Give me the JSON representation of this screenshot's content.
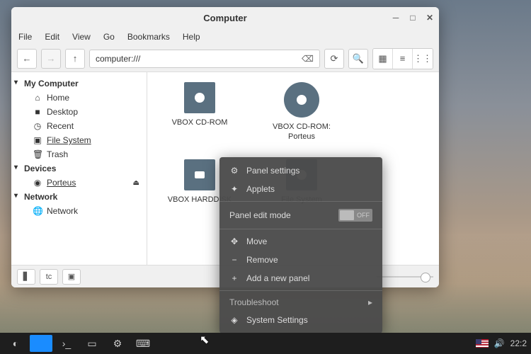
{
  "window": {
    "title": "Computer",
    "menus": [
      "File",
      "Edit",
      "View",
      "Go",
      "Bookmarks",
      "Help"
    ],
    "url": "computer:///"
  },
  "sidebar": {
    "groups": [
      {
        "label": "My Computer",
        "items": [
          {
            "icon": "home-icon",
            "glyph": "⌂",
            "label": "Home"
          },
          {
            "icon": "desktop-icon",
            "glyph": "■",
            "label": "Desktop"
          },
          {
            "icon": "recent-icon",
            "glyph": "◷",
            "label": "Recent"
          },
          {
            "icon": "filesystem-icon",
            "glyph": "▣",
            "label": "File System",
            "selected": true
          },
          {
            "icon": "trash-icon",
            "glyph": "🗑",
            "label": "Trash"
          }
        ]
      },
      {
        "label": "Devices",
        "items": [
          {
            "icon": "disc-icon",
            "glyph": "◉",
            "label": "Porteus",
            "eject": true
          }
        ]
      },
      {
        "label": "Network",
        "items": [
          {
            "icon": "network-icon",
            "glyph": "🌐",
            "label": "Network"
          }
        ]
      }
    ]
  },
  "drives": [
    {
      "label": "VBOX CD-ROM",
      "style": "square"
    },
    {
      "label": "VBOX CD-ROM: Porteus",
      "style": "disc"
    },
    {
      "label": "VBOX HARDDISK",
      "style": "hdd"
    },
    {
      "label": "File System",
      "style": "square"
    }
  ],
  "context": {
    "panel_settings": "Panel settings",
    "applets": "Applets",
    "edit_mode": "Panel edit mode",
    "edit_state": "OFF",
    "move": "Move",
    "remove": "Remove",
    "add": "Add a new panel",
    "troubleshoot": "Troubleshoot",
    "system_settings": "System Settings"
  },
  "taskbar": {
    "time": "22:2"
  }
}
